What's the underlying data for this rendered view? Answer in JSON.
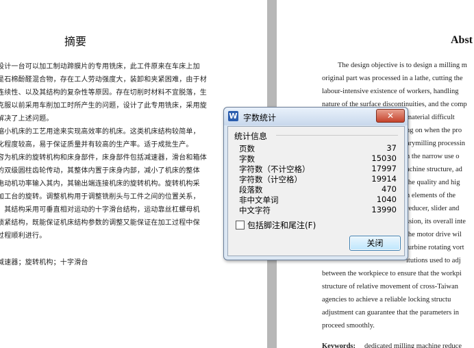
{
  "left_page": {
    "heading": "摘要",
    "lines": [
      "设计一台可以加工制动蹄膜片的专用铣床，此工件原来在车床上加",
      "是石棉酚醛混合物，存在工人劳动强度大，装卸和夹紧困难，由于材",
      "连续性、以及其结构的复杂性等原因。存在切削时材料不宜脱落，生",
      "克服以前采用车削加工时所产生的问题，设计了此专用铣床，采用旋",
      "解决了上述问题。",
      "缩小机床的工艺用途来实现高效率的机床。这类机床结构较简单，",
      "化程度较高，易于保证质量并有较高的生产率。适于成批生产。",
      "容为机床的旋转机构和床身部件，床身部件包括减速器，滑台和箱体",
      "的双级圆柱齿轮传动，其整体内置于床身内部，减小了机床的整体",
      "电动机功率输入其内，其输出端连接机床的旋转机构。旋转机构采",
      "加工台的旋转。调整机构用于调整铣削头与工件之间的位置关系，",
      "：其结构采用可垂直相对运动的十字滑台结构，运动靠丝杠螺母机",
      "锁紧结构，既能保证机床结构参数的调整又能保证在加工过程中保",
      "过程顺利进行。",
      "减速器；旋转机构；十字滑台"
    ]
  },
  "right_page": {
    "heading": "Abst",
    "lines": [
      "The design objective is to design a milling m",
      "original part was processed in a lathe, cutting the",
      "labour-intensive existence of workers, handling",
      "nature of the surface discontinuities, and the comp",
      "material difficult",
      "ng on when the pro",
      "arymilling processin",
      "h the narrow use o",
      "achine structure, ad",
      "the quality and hig",
      "n elements of the",
      "reducer, slider and",
      "ssion, its overall inte",
      "the motor drive wil",
      "turbine rotating vort",
      "itutions used to adj",
      "between the workpiece to ensure that the workpi",
      "structure of relative movement of cross-Taiwan",
      "agencies to achieve a reliable locking structu",
      "adjustment can guarantee that the parameters in",
      "proceed smoothly."
    ],
    "keywords_label": "Keywords:",
    "keywords_text": "dedicated milling machine    reduce"
  },
  "dialog": {
    "icon_letter": "W",
    "title": "字数统计",
    "close_glyph": "✕",
    "group_label": "统计信息",
    "stats": [
      {
        "label": "页数",
        "value": "37"
      },
      {
        "label": "字数",
        "value": "15030"
      },
      {
        "label": "字符数（不计空格）",
        "value": "17997"
      },
      {
        "label": "字符数（计空格）",
        "value": "19914"
      },
      {
        "label": "段落数",
        "value": "470"
      },
      {
        "label": "非中文单词",
        "value": "1040"
      },
      {
        "label": "中文字符",
        "value": "13990"
      }
    ],
    "checkbox_label": "包括脚注和尾注(F)",
    "close_button": "关闭"
  }
}
